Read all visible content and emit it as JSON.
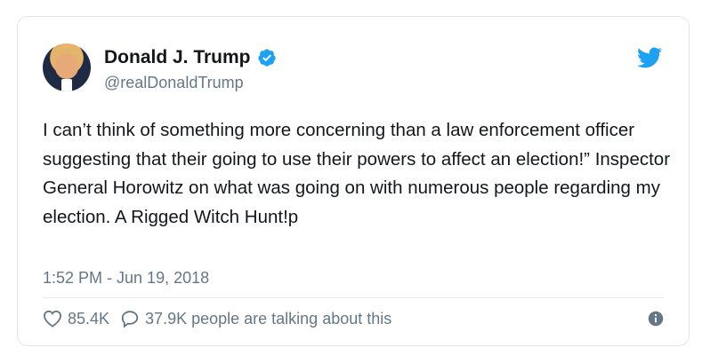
{
  "tweet": {
    "author_name": "Donald J. Trump",
    "handle": "@realDonaldTrump",
    "text": "I can’t think of something more concerning than a law enforcement officer suggesting that their going to use their powers to affect an election!” Inspector General Horowitz on what was going on with numerous people regarding my election. A Rigged Witch Hunt!p",
    "timestamp": "1:52 PM - Jun 19, 2018",
    "likes": "85.4K",
    "talking_about": "37.9K people are talking about this"
  },
  "colors": {
    "twitter_blue": "#1da1f2",
    "secondary_text": "#657786",
    "border": "#e1e8ed"
  },
  "icons": {
    "verified": "verified-badge-icon",
    "twitter": "twitter-bird-icon",
    "like": "heart-icon",
    "reply": "speech-bubble-icon",
    "info": "info-icon"
  }
}
